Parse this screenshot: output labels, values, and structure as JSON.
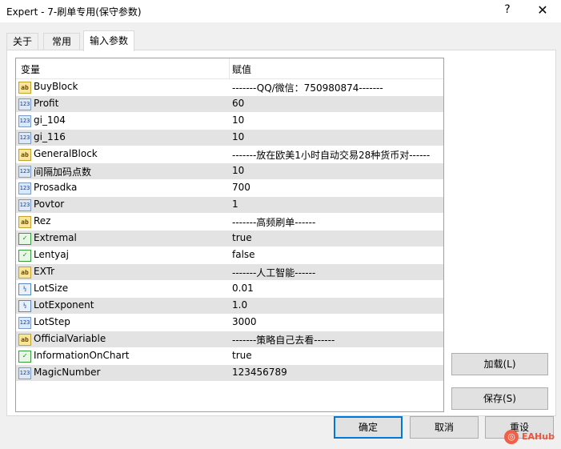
{
  "window": {
    "title": "Expert - 7-刷单专用(保守参数)",
    "help": "?",
    "close": "✕"
  },
  "tabs": [
    {
      "label": "关于"
    },
    {
      "label": "常用"
    },
    {
      "label": "输入参数"
    }
  ],
  "grid": {
    "col_variable": "变量",
    "col_value": "赋值",
    "rows": [
      {
        "type": "ab",
        "icon": "ab",
        "name": "BuyBlock",
        "value": "-------QQ/微信：750980874-------"
      },
      {
        "type": "int",
        "icon": "123",
        "name": "Profit",
        "value": "60"
      },
      {
        "type": "int",
        "icon": "123",
        "name": "gi_104",
        "value": "10"
      },
      {
        "type": "int",
        "icon": "123",
        "name": "gi_116",
        "value": "10"
      },
      {
        "type": "ab",
        "icon": "ab",
        "name": "GeneralBlock",
        "value": "-------放在欧美1小时自动交易28种货币对------"
      },
      {
        "type": "int",
        "icon": "123",
        "name": "间隔加码点数",
        "value": "10"
      },
      {
        "type": "int",
        "icon": "123",
        "name": "Prosadka",
        "value": "700"
      },
      {
        "type": "int",
        "icon": "123",
        "name": "Povtor",
        "value": "1"
      },
      {
        "type": "ab",
        "icon": "ab",
        "name": "Rez",
        "value": "-------高频刷单------"
      },
      {
        "type": "bool",
        "icon": "✓",
        "name": "Extremal",
        "value": "true"
      },
      {
        "type": "bool",
        "icon": "✓",
        "name": "Lentyaj",
        "value": "false"
      },
      {
        "type": "ab",
        "icon": "ab",
        "name": "EXTr",
        "value": "-------人工智能------"
      },
      {
        "type": "dbl",
        "icon": "½",
        "name": "LotSize",
        "value": "0.01"
      },
      {
        "type": "dbl",
        "icon": "½",
        "name": "LotExponent",
        "value": "1.0"
      },
      {
        "type": "int",
        "icon": "123",
        "name": "LotStep",
        "value": "3000"
      },
      {
        "type": "ab",
        "icon": "ab",
        "name": "OfficialVariable",
        "value": "-------策略自己去看------"
      },
      {
        "type": "bool",
        "icon": "✓",
        "name": "InformationOnChart",
        "value": "true"
      },
      {
        "type": "int",
        "icon": "123",
        "name": "MagicNumber",
        "value": "123456789"
      }
    ]
  },
  "buttons": {
    "load": "加载(L)",
    "save": "保存(S)",
    "ok": "确定",
    "cancel": "取消",
    "reset": "重设"
  },
  "watermark": {
    "text": "EAHub"
  }
}
